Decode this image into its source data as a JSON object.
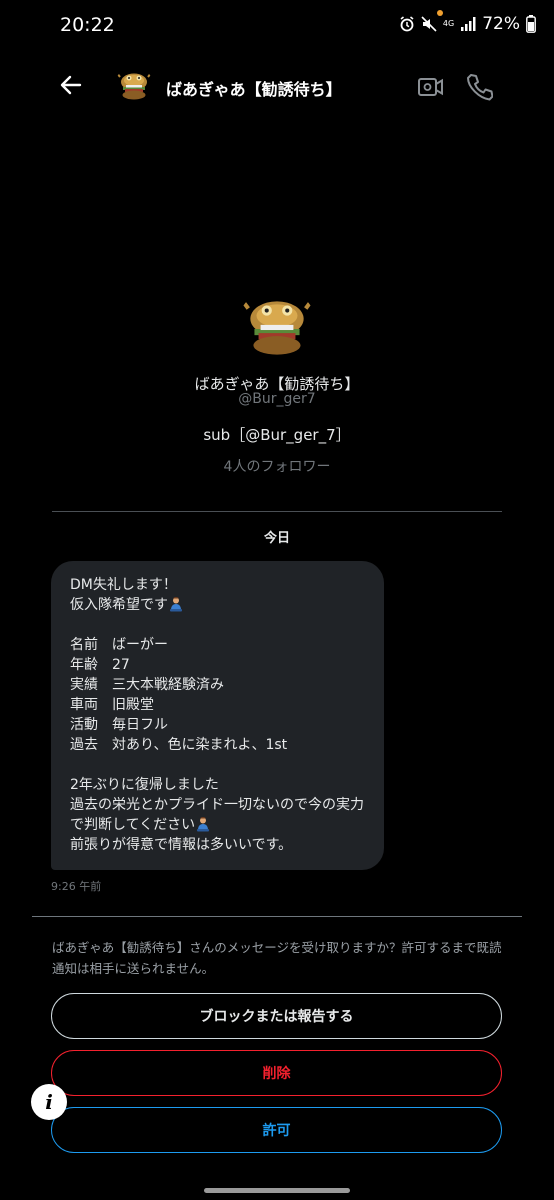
{
  "status_bar": {
    "time": "20:22",
    "battery": "72%",
    "network": "4G"
  },
  "header": {
    "title": "ばあぎゃあ【勧誘待ち】"
  },
  "profile": {
    "name": "ばあぎゃあ【勧誘待ち】",
    "handle": "@Bur_ger7",
    "bio": "sub［@Bur_ger_7］",
    "followers": "4人のフォロワー"
  },
  "conversation": {
    "date_separator": "今日",
    "message": {
      "lines": [
        "DM失礼します！",
        "仮入隊希望です",
        "",
        "名前　ばーがー",
        "年齢　27",
        "実績　三大本戦経験済み",
        "車両　旧殿堂",
        "活動　毎日フル",
        "過去　対あり、色に染まれよ、1st",
        "",
        "2年ぶりに復帰しました",
        "過去の栄光とかプライド一切ないので今の実力",
        "で判断してください",
        "前張りが得意で情報は多いいです。"
      ],
      "time": "9:26 午前"
    }
  },
  "request": {
    "prompt": "ばあぎゃあ【勧誘待ち】さんのメッセージを受け取りますか？許可するまで既読通知は相手に送られません。",
    "block_label": "ブロックまたは報告する",
    "delete_label": "削除",
    "allow_label": "許可"
  },
  "colors": {
    "background": "#000000",
    "bubble": "#202327",
    "danger": "#f4212e",
    "accent": "#1d9bf0"
  }
}
